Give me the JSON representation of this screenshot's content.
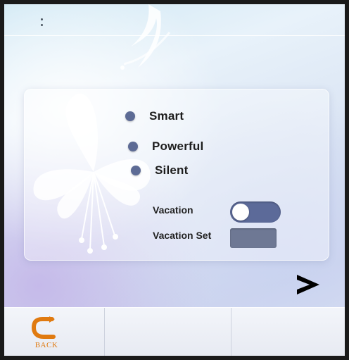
{
  "header": {
    "menu_icon": "vertical-dots-icon"
  },
  "modes": [
    {
      "label": "Smart"
    },
    {
      "label": "Powerful"
    },
    {
      "label": "Silent"
    }
  ],
  "vacation": {
    "label": "Vacation",
    "toggle_state": "off"
  },
  "vacation_set": {
    "label": "Vacation Set"
  },
  "navigation": {
    "next_icon": "chevron-right-icon",
    "back_icon": "back-arrow-icon",
    "back_label": "BACK"
  },
  "colors": {
    "accent": "#5d6b95",
    "toggle_track": "#5c6a99",
    "back_orange": "#e07a10"
  }
}
